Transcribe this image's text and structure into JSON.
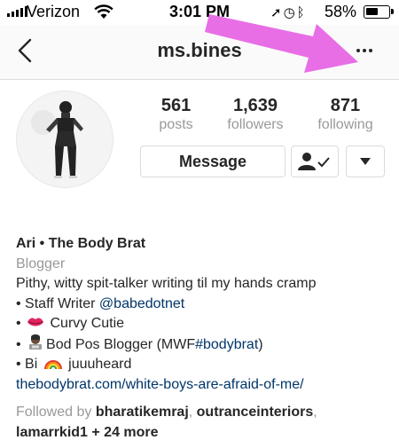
{
  "status_bar": {
    "carrier": "Verizon",
    "time": "3:01 PM",
    "battery_percent": "58%",
    "battery_level": 0.58
  },
  "nav": {
    "username": "ms.bines"
  },
  "stats": [
    {
      "value": "561",
      "label": "posts"
    },
    {
      "value": "1,639",
      "label": "followers"
    },
    {
      "value": "871",
      "label": "following"
    }
  ],
  "actions": {
    "message_label": "Message"
  },
  "bio": {
    "name": "Ari • The Body Brat",
    "category": "Blogger",
    "line1": "Pithy, witty spit-talker writing til my hands cramp",
    "line2_prefix": "• Staff Writer ",
    "line2_handle": "@babedotnet",
    "line3_prefix": "• ",
    "line3_text": " Curvy Cutie",
    "line4_prefix": "• ",
    "line4_text": "Bod Pos Blogger (MWF",
    "line4_tag": "#bodybrat",
    "line4_suffix": ")",
    "line5_prefix": "• Bi ",
    "line5_text": " juuuheard",
    "website": "thebodybrat.com/white-boys-are-afraid-of-me/",
    "followed_by_prefix": "Followed by ",
    "follower1": "bharatikemraj",
    "sep1": ", ",
    "follower2": "outranceinteriors",
    "sep2": ",",
    "follower3": "lamarrkid1",
    "more": " + 24 more"
  },
  "colors": {
    "arrow": "#e86ee6",
    "link": "#003569",
    "muted": "#999999"
  },
  "icons": [
    "back-chevron-icon",
    "more-options-icon",
    "following-icon",
    "dropdown-caret-icon",
    "wifi-icon",
    "location-icon",
    "alarm-icon",
    "bluetooth-icon"
  ]
}
